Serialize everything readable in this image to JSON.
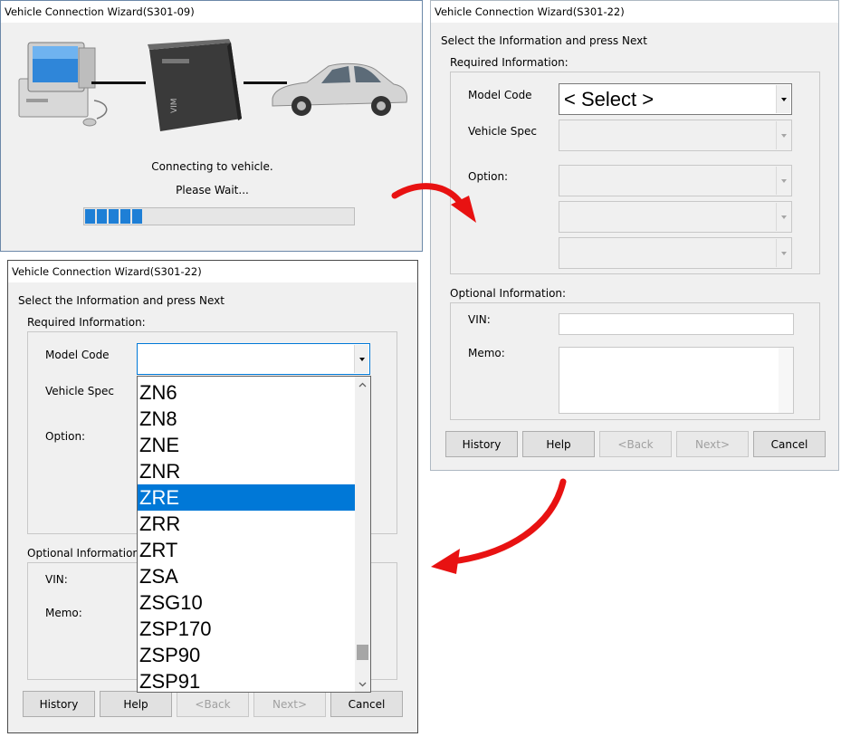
{
  "connect_window": {
    "title": "Vehicle Connection Wizard(S301-09)",
    "status_line1": "Connecting to vehicle.",
    "status_line2": "Please Wait...",
    "progress_fraction": 0.24,
    "device_label": "VIM"
  },
  "info_window": {
    "title": "Vehicle Connection Wizard(S301-22)",
    "instruction": "Select the Information and press Next",
    "required_label": "Required Information:",
    "model_code_label": "Model Code",
    "model_code_value": "< Select >",
    "vehicle_spec_label": "Vehicle Spec",
    "option_label": "Option:",
    "optional_label": "Optional Information:",
    "vin_label": "VIN:",
    "memo_label": "Memo:",
    "buttons": {
      "history": "History",
      "help": "Help",
      "back": "<Back",
      "next": "Next>",
      "cancel": "Cancel"
    }
  },
  "dropdown_window": {
    "title": "Vehicle Connection Wizard(S301-22)",
    "instruction": "Select the Information and press Next",
    "required_label": "Required Information:",
    "model_code_label": "Model Code",
    "vehicle_spec_label": "Vehicle Spec",
    "option_label": "Option:",
    "optional_label": "Optional Information:",
    "vin_label": "VIN:",
    "memo_label": "Memo:",
    "model_code_options": [
      "ZN6",
      "ZN8",
      "ZNE",
      "ZNR",
      "ZRE",
      "ZRR",
      "ZRT",
      "ZSA",
      "ZSG10",
      "ZSP170",
      "ZSP90",
      "ZSP91"
    ],
    "highlighted_option": "ZRE",
    "buttons": {
      "history": "History",
      "help": "Help",
      "back": "<Back",
      "next": "Next>",
      "cancel": "Cancel"
    }
  },
  "colors": {
    "selection": "#0078d7",
    "progress": "#1e7fd6",
    "arrow": "#e81212",
    "dialog_bg": "#f0f0f0"
  }
}
